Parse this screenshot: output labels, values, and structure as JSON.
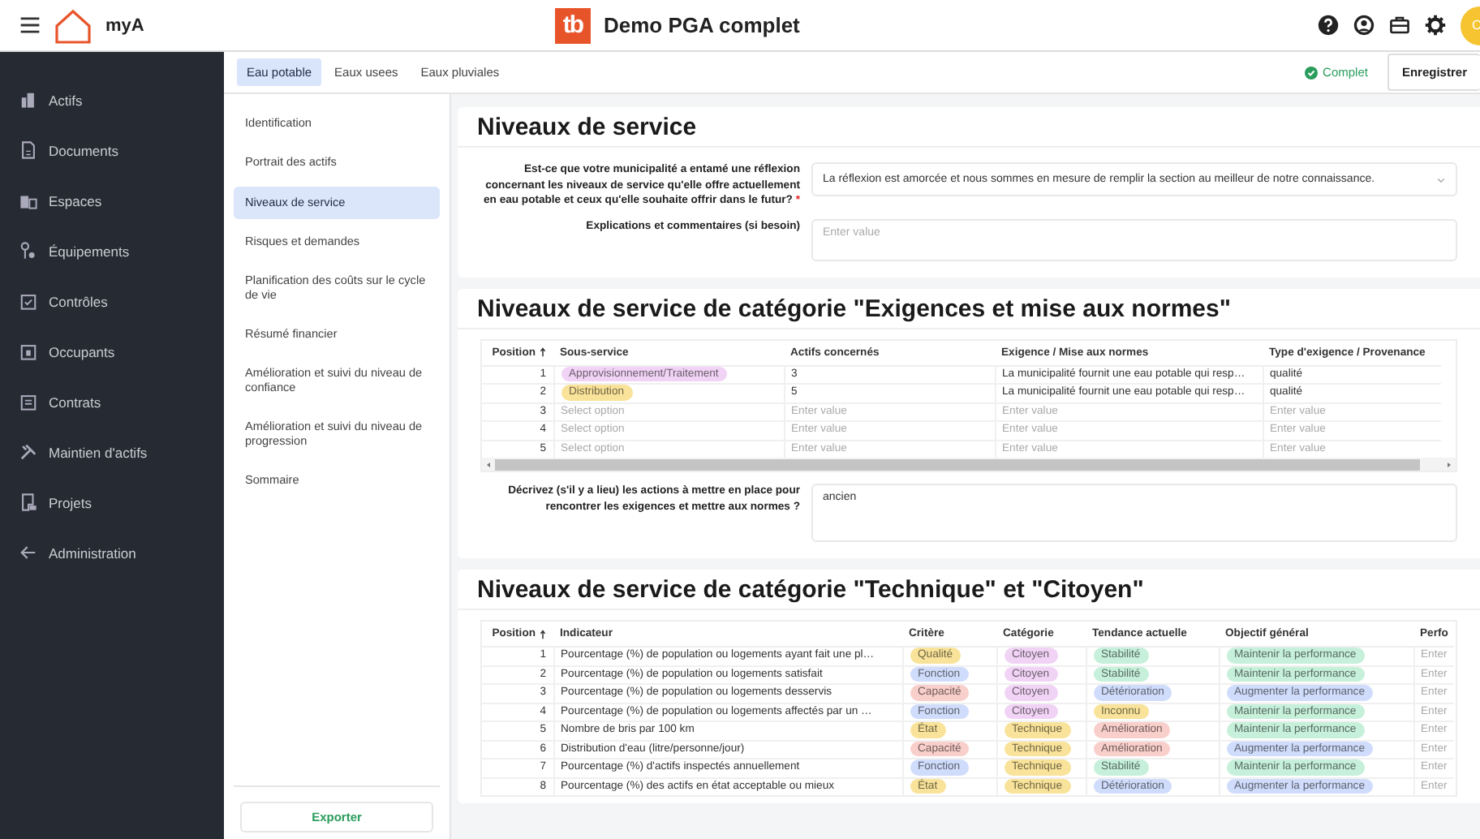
{
  "topbar": {
    "app_name": "myA",
    "logo_text": "tb",
    "title": "Demo PGA complet",
    "avatar": "C"
  },
  "sidebar": {
    "items": [
      {
        "label": "Actifs"
      },
      {
        "label": "Documents"
      },
      {
        "label": "Espaces"
      },
      {
        "label": "Équipements"
      },
      {
        "label": "Contrôles"
      },
      {
        "label": "Occupants"
      },
      {
        "label": "Contrats"
      },
      {
        "label": "Maintien d'actifs"
      },
      {
        "label": "Projets"
      },
      {
        "label": "Administration"
      }
    ]
  },
  "tabs": [
    {
      "label": "Eau potable",
      "selected": true
    },
    {
      "label": "Eaux usees",
      "selected": false
    },
    {
      "label": "Eaux pluviales",
      "selected": false
    }
  ],
  "status": "Complet",
  "save_button": "Enregistrer",
  "subnav": {
    "items": [
      {
        "label": "Identification",
        "selected": false
      },
      {
        "label": "Portrait des actifs",
        "selected": false
      },
      {
        "label": "Niveaux de service",
        "selected": true
      },
      {
        "label": "Risques et demandes",
        "selected": false
      },
      {
        "label": "Planification des coûts sur le cycle de vie",
        "selected": false
      },
      {
        "label": "Résumé financier",
        "selected": false
      },
      {
        "label": "Amélioration et suivi du niveau de confiance",
        "selected": false
      },
      {
        "label": "Amélioration et suivi du niveau de progression",
        "selected": false
      },
      {
        "label": "Sommaire",
        "selected": false
      }
    ],
    "export_button": "Exporter"
  },
  "sections": [
    {
      "title": "Niveaux de service",
      "fields": [
        {
          "kind": "select",
          "label": "Est-ce que votre municipalité a entamé une réflexion concernant les niveaux de service qu'elle offre actuellement en eau potable et ceux qu'elle souhaite offrir dans le futur?",
          "required_mark": "*",
          "value": "La réflexion est amorcée et nous sommes en mesure de remplir la section au meilleur de notre connaissance."
        },
        {
          "kind": "textarea",
          "label": "Explications et commentaires (si besoin)",
          "placeholder": "Enter value"
        }
      ]
    },
    {
      "title": "Niveaux de service de catégorie \"Exigences et mise aux normes\"",
      "table": {
        "columns": [
          "Position",
          "Sous-service",
          "Actifs concernés",
          "Exigence / Mise aux normes",
          "Type d'exigence / Provenance"
        ],
        "rows": [
          {
            "cells": [
              {
                "kind": "position",
                "text": "1"
              },
              {
                "kind": "tag",
                "text": "Approvisionnement/Traitement",
                "color": "#f1d4f5"
              },
              {
                "kind": "text",
                "text": "3"
              },
              {
                "kind": "text",
                "text": "La municipalité fournit une eau potable qui resp…"
              },
              {
                "kind": "text",
                "text": "qualité"
              }
            ]
          },
          {
            "cells": [
              {
                "kind": "position",
                "text": "2"
              },
              {
                "kind": "tag",
                "text": "Distribution",
                "color": "#f9e39a"
              },
              {
                "kind": "text",
                "text": "5"
              },
              {
                "kind": "text",
                "text": "La municipalité fournit une eau potable qui resp…"
              },
              {
                "kind": "text",
                "text": "qualité"
              }
            ]
          },
          {
            "cells": [
              {
                "kind": "position",
                "text": "3"
              },
              {
                "kind": "placeholder",
                "text": "Select option"
              },
              {
                "kind": "placeholder",
                "text": "Enter value"
              },
              {
                "kind": "placeholder",
                "text": "Enter value"
              },
              {
                "kind": "placeholder",
                "text": "Enter value"
              }
            ]
          },
          {
            "cells": [
              {
                "kind": "position",
                "text": "4"
              },
              {
                "kind": "placeholder",
                "text": "Select option"
              },
              {
                "kind": "placeholder",
                "text": "Enter value"
              },
              {
                "kind": "placeholder",
                "text": "Enter value"
              },
              {
                "kind": "placeholder",
                "text": "Enter value"
              }
            ]
          },
          {
            "cells": [
              {
                "kind": "position",
                "text": "5"
              },
              {
                "kind": "placeholder",
                "text": "Select option"
              },
              {
                "kind": "placeholder",
                "text": "Enter value"
              },
              {
                "kind": "placeholder",
                "text": "Enter value"
              },
              {
                "kind": "placeholder",
                "text": "Enter value"
              }
            ]
          }
        ]
      },
      "fields": [
        {
          "kind": "textarea",
          "label": "Décrivez (s'il y a lieu) les actions à mettre en place pour rencontrer les exigences et mettre aux normes ?",
          "value": "ancien"
        }
      ]
    },
    {
      "title": "Niveaux de service de catégorie \"Technique\" et \"Citoyen\"",
      "table": {
        "columns": [
          "Position",
          "Indicateur",
          "Critère",
          "Catégorie",
          "Tendance actuelle",
          "Objectif général",
          "Perfo"
        ],
        "rows": [
          {
            "cells": [
              {
                "kind": "position",
                "text": "1"
              },
              {
                "kind": "text",
                "text": "Pourcentage (%) de population ou logements ayant fait une pl…"
              },
              {
                "kind": "tag",
                "text": "Qualité",
                "color": "#f9e39a"
              },
              {
                "kind": "tag",
                "text": "Citoyen",
                "color": "#f1d4f5"
              },
              {
                "kind": "tag",
                "text": "Stabilité",
                "color": "#c6f0da"
              },
              {
                "kind": "tag",
                "text": "Maintenir la performance",
                "color": "#c6f0da"
              },
              {
                "kind": "placeholder",
                "text": "Enter"
              }
            ]
          },
          {
            "cells": [
              {
                "kind": "position",
                "text": "2"
              },
              {
                "kind": "text",
                "text": "Pourcentage (%) de population ou logements satisfait"
              },
              {
                "kind": "tag",
                "text": "Fonction",
                "color": "#d0dcfb"
              },
              {
                "kind": "tag",
                "text": "Citoyen",
                "color": "#f1d4f5"
              },
              {
                "kind": "tag",
                "text": "Stabilité",
                "color": "#c6f0da"
              },
              {
                "kind": "tag",
                "text": "Maintenir la performance",
                "color": "#c6f0da"
              },
              {
                "kind": "placeholder",
                "text": "Enter"
              }
            ]
          },
          {
            "cells": [
              {
                "kind": "position",
                "text": "3"
              },
              {
                "kind": "text",
                "text": "Pourcentage (%) de population ou logements desservis"
              },
              {
                "kind": "tag",
                "text": "Capacité",
                "color": "#f9cfcb"
              },
              {
                "kind": "tag",
                "text": "Citoyen",
                "color": "#f1d4f5"
              },
              {
                "kind": "tag",
                "text": "Détérioration",
                "color": "#d0dcfb"
              },
              {
                "kind": "tag",
                "text": "Augmenter la performance",
                "color": "#d0dcfb"
              },
              {
                "kind": "placeholder",
                "text": "Enter"
              }
            ]
          },
          {
            "cells": [
              {
                "kind": "position",
                "text": "4"
              },
              {
                "kind": "text",
                "text": "Pourcentage (%) de population ou logements affectés par un …"
              },
              {
                "kind": "tag",
                "text": "Fonction",
                "color": "#d0dcfb"
              },
              {
                "kind": "tag",
                "text": "Citoyen",
                "color": "#f1d4f5"
              },
              {
                "kind": "tag",
                "text": "Inconnu",
                "color": "#f9e39a"
              },
              {
                "kind": "tag",
                "text": "Maintenir la performance",
                "color": "#c6f0da"
              },
              {
                "kind": "placeholder",
                "text": "Enter"
              }
            ]
          },
          {
            "cells": [
              {
                "kind": "position",
                "text": "5"
              },
              {
                "kind": "text",
                "text": "Nombre de bris par 100 km"
              },
              {
                "kind": "tag",
                "text": "État",
                "color": "#f9e39a"
              },
              {
                "kind": "tag",
                "text": "Technique",
                "color": "#f9e39a"
              },
              {
                "kind": "tag",
                "text": "Amélioration",
                "color": "#f9cfcb"
              },
              {
                "kind": "tag",
                "text": "Maintenir la performance",
                "color": "#c6f0da"
              },
              {
                "kind": "placeholder",
                "text": "Enter"
              }
            ]
          },
          {
            "cells": [
              {
                "kind": "position",
                "text": "6"
              },
              {
                "kind": "text",
                "text": "Distribution d'eau (litre/personne/jour)"
              },
              {
                "kind": "tag",
                "text": "Capacité",
                "color": "#f9cfcb"
              },
              {
                "kind": "tag",
                "text": "Technique",
                "color": "#f9e39a"
              },
              {
                "kind": "tag",
                "text": "Amélioration",
                "color": "#f9cfcb"
              },
              {
                "kind": "tag",
                "text": "Augmenter la performance",
                "color": "#d0dcfb"
              },
              {
                "kind": "placeholder",
                "text": "Enter"
              }
            ]
          },
          {
            "cells": [
              {
                "kind": "position",
                "text": "7"
              },
              {
                "kind": "text",
                "text": "Pourcentage (%) d'actifs inspectés annuellement"
              },
              {
                "kind": "tag",
                "text": "Fonction",
                "color": "#d0dcfb"
              },
              {
                "kind": "tag",
                "text": "Technique",
                "color": "#f9e39a"
              },
              {
                "kind": "tag",
                "text": "Stabilité",
                "color": "#c6f0da"
              },
              {
                "kind": "tag",
                "text": "Maintenir la performance",
                "color": "#c6f0da"
              },
              {
                "kind": "placeholder",
                "text": "Enter"
              }
            ]
          },
          {
            "cells": [
              {
                "kind": "position",
                "text": "8"
              },
              {
                "kind": "text",
                "text": "Pourcentage (%) des actifs en état acceptable ou mieux"
              },
              {
                "kind": "tag",
                "text": "État",
                "color": "#f9e39a"
              },
              {
                "kind": "tag",
                "text": "Technique",
                "color": "#f9e39a"
              },
              {
                "kind": "tag",
                "text": "Détérioration",
                "color": "#d0dcfb"
              },
              {
                "kind": "tag",
                "text": "Augmenter la performance",
                "color": "#d0dcfb"
              },
              {
                "kind": "placeholder",
                "text": "Enter"
              }
            ]
          }
        ]
      }
    }
  ]
}
